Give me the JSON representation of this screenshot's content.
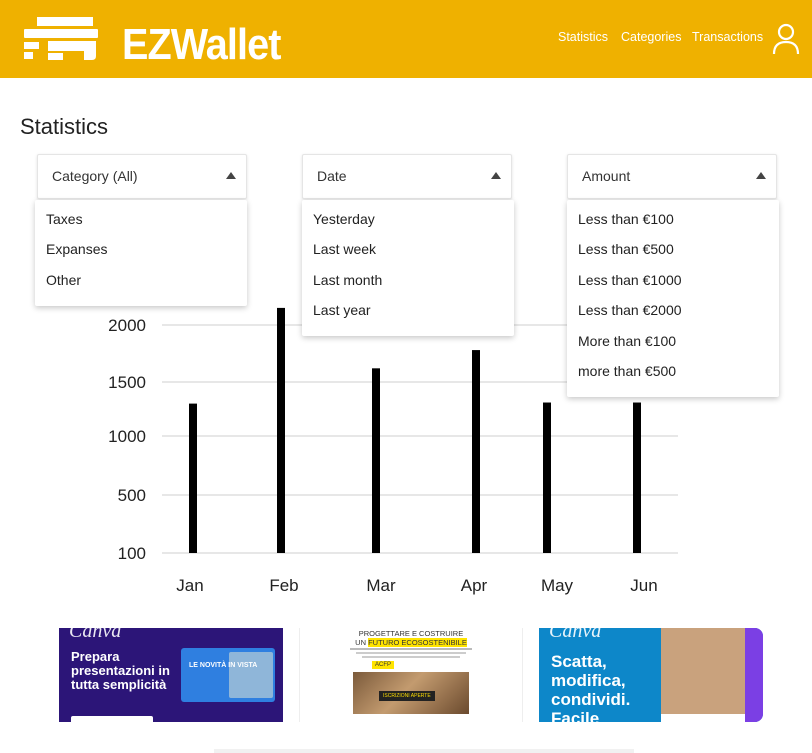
{
  "header": {
    "brand": "EZWallet",
    "nav": [
      "Statistics",
      "Categories",
      "Transactions"
    ],
    "colors": {
      "background": "#efb100",
      "text": "#ffffff"
    },
    "user_icon": "user-icon"
  },
  "page": {
    "title": "Statistics"
  },
  "filters": {
    "category": {
      "label": "Category (All)",
      "options": [
        "Taxes",
        "Expanses",
        "Other"
      ]
    },
    "date": {
      "label": "Date",
      "options": [
        "Yesterday",
        "Last week",
        "Last month",
        "Last year"
      ]
    },
    "amount": {
      "label": "Amount",
      "options": [
        "Less than €100",
        "Less than €500",
        "Less than €1000",
        "Less than €2000",
        "More than €100",
        "more than €500"
      ]
    }
  },
  "chart_data": {
    "type": "bar",
    "categories": [
      "Jan",
      "Feb",
      "Mar",
      "Apr",
      "May",
      "Jun"
    ],
    "values": [
      1300,
      2150,
      1620,
      1780,
      1310,
      1310
    ],
    "yticks": [
      100,
      500,
      1000,
      1500,
      2000
    ],
    "grid": true,
    "bar_color": "#000000"
  },
  "ads": {
    "left": {
      "brand": "Canva",
      "headline": "Prepara presentazioni in tutta semplicità",
      "card_text": "LE NOVITÀ IN VISTA"
    },
    "middle": {
      "title_line1": "PROGETTARE E COSTRUIRE",
      "title_line2_prefix": "UN ",
      "title_line2_highlight": "FUTURO ECOSOSTENIBILE",
      "tag": "ACFP",
      "cta": "ISCRIZIONI APERTE"
    },
    "right": {
      "brand": "Canva",
      "headline": "Scatta, modifica, condividi. Facile"
    }
  }
}
